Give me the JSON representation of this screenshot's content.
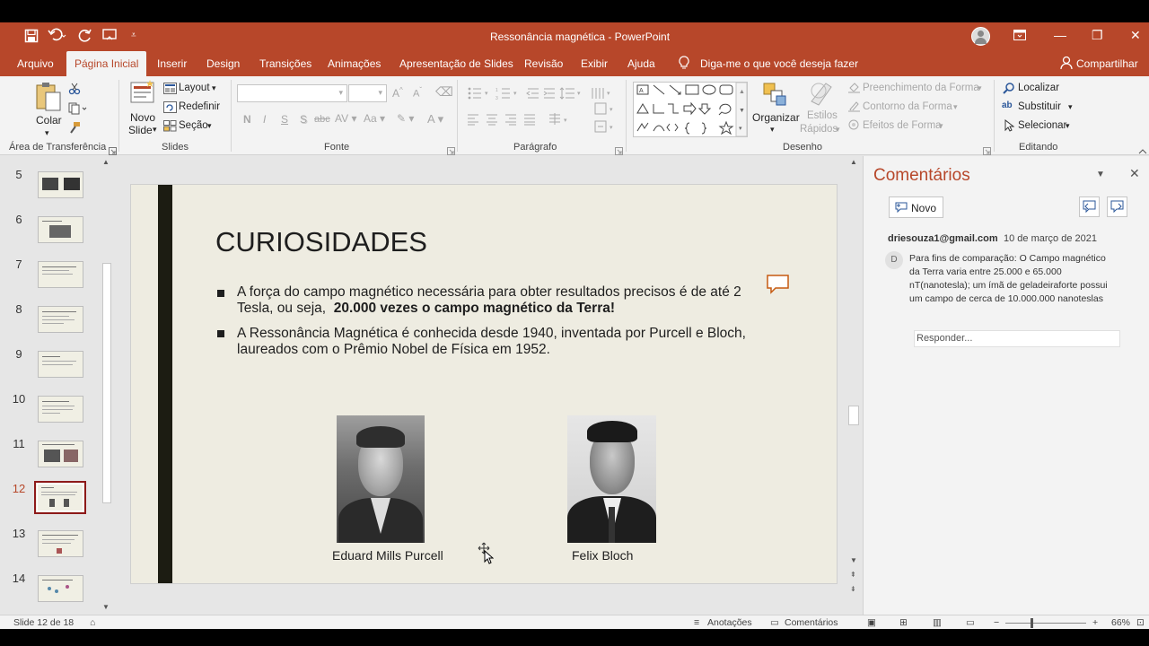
{
  "window": {
    "title": "Ressonância magnética  -  PowerPoint",
    "minimize": "—",
    "maximize": "❐",
    "close": "✕"
  },
  "tabs": [
    "Arquivo",
    "Página Inicial",
    "Inserir",
    "Design",
    "Transições",
    "Animações",
    "Apresentação de Slides",
    "Revisão",
    "Exibir",
    "Ajuda"
  ],
  "tell_me": "Diga-me o que você deseja fazer",
  "share": "Compartilhar",
  "ribbon": {
    "clipboard": {
      "paste": "Colar",
      "label": "Área de Transferência"
    },
    "slides": {
      "new_slide_1": "Novo",
      "new_slide_2": "Slide",
      "layout": "Layout",
      "reset": "Redefinir",
      "section": "Seção",
      "label": "Slides"
    },
    "font": {
      "label": "Fonte",
      "bold": "N",
      "italic": "I",
      "underline": "S",
      "shadow": "S",
      "strike": "abc"
    },
    "paragraph": {
      "label": "Parágrafo"
    },
    "drawing": {
      "arrange": "Organizar",
      "quick_styles_1": "Estilos",
      "quick_styles_2": "Rápidos",
      "fill": "Preenchimento da Forma",
      "outline": "Contorno da Forma",
      "effects": "Efeitos de Forma",
      "label": "Desenho"
    },
    "editing": {
      "find": "Localizar",
      "replace": "Substituir",
      "select": "Selecionar",
      "label": "Editando"
    }
  },
  "thumbnails": [
    "5",
    "6",
    "7",
    "8",
    "9",
    "10",
    "11",
    "12",
    "13",
    "14"
  ],
  "selected_slide": "12",
  "slide": {
    "title": "CURIOSIDADES",
    "bullet1_line1": "A força do campo magnético necessária para obter resultados precisos é de até 2",
    "bullet1_line2a": "Tesla, ou seja,",
    "bullet1_line2b": "20.000 vezes o campo magnético da Terra!",
    "bullet2_line1": "A Ressonância Magnética é conhecida desde 1940, inventada por Purcell e Bloch,",
    "bullet2_line2": "laureados com o Prêmio Nobel de Física em 1952.",
    "caption1": "Eduard Mills Purcell",
    "caption2": "Felix Bloch"
  },
  "comments_pane": {
    "title": "Comentários",
    "new_button": "Novo",
    "author": "driesouza1@gmail.com",
    "date": "10 de março de 2021",
    "avatar_letter": "D",
    "text_lines": [
      "Para fins de comparação: O Campo magnético",
      "da Terra varia entre 25.000 e 65.000",
      "nT(nanotesla); um ímã de geladeiraforte possui",
      "um campo de cerca de 10.000.000 nanoteslas"
    ],
    "reply_placeholder": "Responder..."
  },
  "status_bar": {
    "slide_info": "Slide 12 de 18",
    "notes": "Anotações",
    "comments": "Comentários",
    "zoom": "66%"
  },
  "colors": {
    "accent": "#b7472a",
    "slide_bg": "#eeece1",
    "slide_bar": "#1c1c12",
    "comment_icon": "#c55a11"
  }
}
